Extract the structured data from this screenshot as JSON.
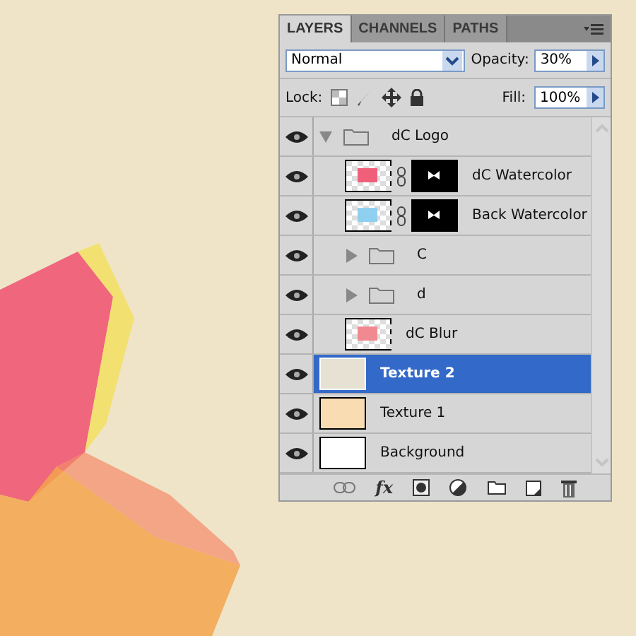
{
  "panel": {
    "tabs": [
      {
        "label": "LAYERS",
        "selected": true
      },
      {
        "label": "CHANNELS",
        "selected": false
      },
      {
        "label": "PATHS",
        "selected": false
      }
    ],
    "blend_mode": {
      "value": "Normal"
    },
    "opacity": {
      "label": "Opacity:",
      "value": "30%"
    },
    "lock": {
      "label": "Lock:"
    },
    "fill": {
      "label": "Fill:",
      "value": "100%"
    },
    "layers": [
      {
        "name": "dC Logo",
        "kind": "group",
        "expanded": true,
        "visible": true,
        "selected": false,
        "children": [
          {
            "name": "dC Watercolor",
            "kind": "layer",
            "transparent": true,
            "mask": true,
            "color": "#f0607a",
            "visible": true,
            "selected": false
          },
          {
            "name": "Back Watercolor",
            "kind": "layer",
            "transparent": true,
            "mask": true,
            "color": "#8fd0f0",
            "visible": true,
            "selected": false
          },
          {
            "name": "C",
            "kind": "group",
            "expanded": false,
            "visible": true,
            "selected": false
          },
          {
            "name": "d",
            "kind": "group",
            "expanded": false,
            "visible": true,
            "selected": false
          },
          {
            "name": "dC Blur",
            "kind": "layer",
            "transparent": true,
            "mask": false,
            "color": "#f08a90",
            "visible": true,
            "selected": false
          }
        ]
      },
      {
        "name": "Texture 2",
        "kind": "layer",
        "transparent": false,
        "mask": false,
        "color": "#e6e1d2",
        "visible": true,
        "selected": true
      },
      {
        "name": "Texture 1",
        "kind": "layer",
        "transparent": false,
        "mask": false,
        "color": "#f9dcb2",
        "visible": true,
        "selected": false
      },
      {
        "name": "Background",
        "kind": "layer",
        "transparent": false,
        "mask": false,
        "color": "#ffffff",
        "visible": true,
        "selected": false
      }
    ],
    "footer": {
      "fx_label": "fx"
    }
  }
}
